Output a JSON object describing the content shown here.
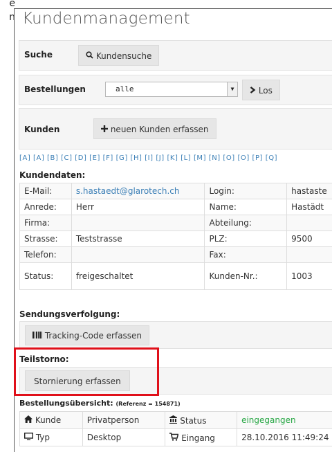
{
  "page": {
    "title": "Kundenmanagement",
    "left_cut_1": "e",
    "left_cut_2": "n"
  },
  "search": {
    "label": "Suche",
    "button": "Kundensuche"
  },
  "orders": {
    "label": "Bestellungen",
    "selected": "alle",
    "go_button": "Los"
  },
  "customers": {
    "label": "Kunden",
    "new_button": "neuen Kunden erfassen"
  },
  "alphabet": "[A] [Ä] [B] [C] [D] [E] [F] [G] [H] [I] [J] [K] [L] [M] [N] [O] [Ö] [P] [Q]",
  "customer_data": {
    "heading": "Kundendaten:",
    "rows": [
      {
        "l1": "E-Mail:",
        "v1": "s.hastaedt@glarotech.ch",
        "l2": "Login:",
        "v2": "hastaste"
      },
      {
        "l1": "Anrede:",
        "v1": "Herr",
        "l2": "Name:",
        "v2": "Hastädt"
      },
      {
        "l1": "Firma:",
        "v1": "",
        "l2": "Abteilung:",
        "v2": ""
      },
      {
        "l1": "Strasse:",
        "v1": "Teststrasse",
        "l2": "PLZ:",
        "v2": "9500"
      },
      {
        "l1": "Telefon:",
        "v1": "",
        "l2": "Fax:",
        "v2": ""
      },
      {
        "l1": "Status:",
        "v1": "freigeschaltet",
        "l2": "Kunden-Nr.:",
        "v2": "1003"
      }
    ]
  },
  "tracking": {
    "heading": "Sendungsverfolgung:",
    "button": "Tracking-Code erfassen"
  },
  "cancel": {
    "heading": "Teilstorno:",
    "button": "Stornierung erfassen"
  },
  "overview": {
    "heading": "Bestellungsübersicht:",
    "reference": "(Referenz = 154871)",
    "rows": [
      {
        "l1": "Kunde",
        "v1": "Privatperson",
        "l2": "Status",
        "v2": "eingegangen"
      },
      {
        "l1": "Typ",
        "v1": "Desktop",
        "l2": "Eingang",
        "v2": "28.10.2016 11:49:24"
      }
    ]
  },
  "colors": {
    "link": "#3b7fb6",
    "status_green": "#28a745",
    "highlight": "#e0101a"
  }
}
